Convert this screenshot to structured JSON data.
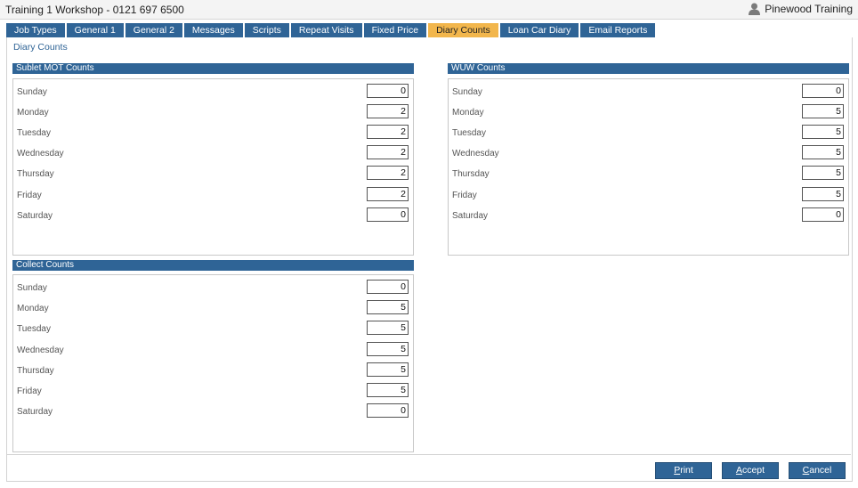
{
  "window": {
    "title": "Training 1 Workshop - 0121 697 6500",
    "user_name": "Pinewood Training"
  },
  "tabs": [
    {
      "label": "Job Types"
    },
    {
      "label": "General 1"
    },
    {
      "label": "General 2"
    },
    {
      "label": "Messages"
    },
    {
      "label": "Scripts"
    },
    {
      "label": "Repeat Visits"
    },
    {
      "label": "Fixed Price"
    },
    {
      "label": "Diary Counts",
      "active": true
    },
    {
      "label": "Loan Car Diary"
    },
    {
      "label": "Email Reports"
    }
  ],
  "page": {
    "section_title": "Diary Counts"
  },
  "sublet_mot": {
    "title": "Sublet MOT Counts",
    "rows": [
      {
        "day": "Sunday",
        "value": "0"
      },
      {
        "day": "Monday",
        "value": "2"
      },
      {
        "day": "Tuesday",
        "value": "2"
      },
      {
        "day": "Wednesday",
        "value": "2"
      },
      {
        "day": "Thursday",
        "value": "2"
      },
      {
        "day": "Friday",
        "value": "2"
      },
      {
        "day": "Saturday",
        "value": "0"
      }
    ]
  },
  "wuw": {
    "title": "WUW Counts",
    "rows": [
      {
        "day": "Sunday",
        "value": "0"
      },
      {
        "day": "Monday",
        "value": "5"
      },
      {
        "day": "Tuesday",
        "value": "5"
      },
      {
        "day": "Wednesday",
        "value": "5"
      },
      {
        "day": "Thursday",
        "value": "5"
      },
      {
        "day": "Friday",
        "value": "5"
      },
      {
        "day": "Saturday",
        "value": "0"
      }
    ]
  },
  "collect": {
    "title": "Collect Counts",
    "rows": [
      {
        "day": "Sunday",
        "value": "0"
      },
      {
        "day": "Monday",
        "value": "5"
      },
      {
        "day": "Tuesday",
        "value": "5"
      },
      {
        "day": "Wednesday",
        "value": "5"
      },
      {
        "day": "Thursday",
        "value": "5"
      },
      {
        "day": "Friday",
        "value": "5"
      },
      {
        "day": "Saturday",
        "value": "0"
      }
    ]
  },
  "buttons": {
    "print": {
      "hotkey": "P",
      "rest": "rint"
    },
    "accept": {
      "hotkey": "A",
      "rest": "ccept"
    },
    "cancel": {
      "hotkey": "C",
      "rest": "ancel"
    }
  },
  "colors": {
    "tab_bg": "#2f6496",
    "tab_active_bg": "#f2b64c",
    "panel_header_bg": "#2f6496",
    "button_bg": "#2f6496"
  },
  "icons": {
    "user": "user-icon"
  }
}
